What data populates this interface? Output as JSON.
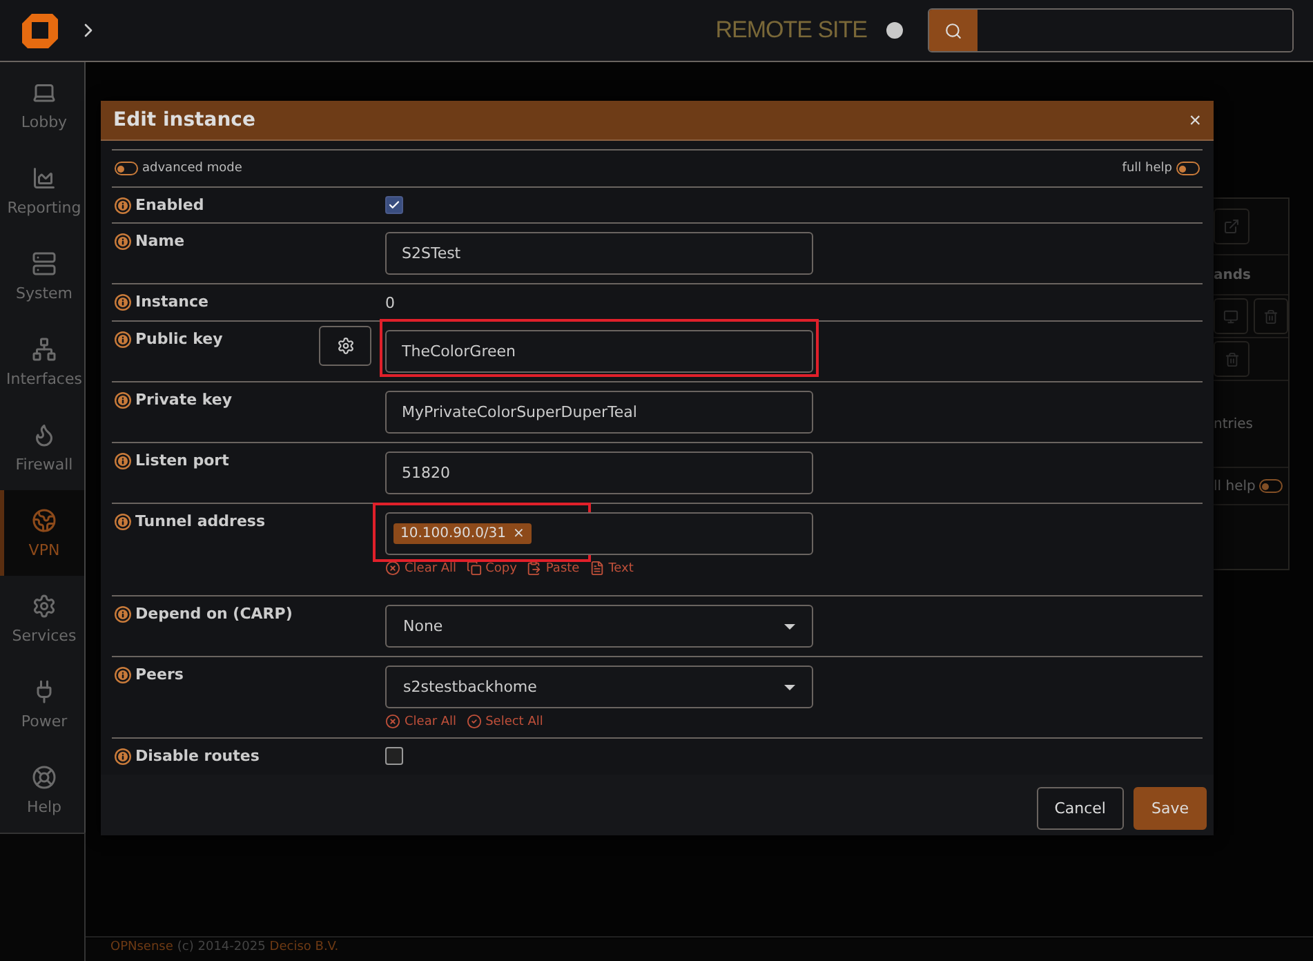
{
  "topbar": {
    "site_label": "REMOTE SITE"
  },
  "sidebar": {
    "items": [
      {
        "label": "Lobby",
        "selected": false
      },
      {
        "label": "Reporting",
        "selected": false
      },
      {
        "label": "System",
        "selected": false
      },
      {
        "label": "Interfaces",
        "selected": false
      },
      {
        "label": "Firewall",
        "selected": false
      },
      {
        "label": "VPN",
        "selected": true
      },
      {
        "label": "Services",
        "selected": false
      },
      {
        "label": "Power",
        "selected": false
      },
      {
        "label": "Help",
        "selected": false
      }
    ]
  },
  "background_panel": {
    "column_header": "ands",
    "text": "ntries",
    "help_toggle": {
      "label": "ll help",
      "on": false
    }
  },
  "dialog": {
    "title": "Edit instance",
    "close": "×",
    "advanced_mode": {
      "label": "advanced mode",
      "on": false
    },
    "full_help": {
      "label": "full help",
      "on": false
    },
    "fields": [
      {
        "kind": "checkbox",
        "label": "Enabled",
        "checked": true
      },
      {
        "kind": "input",
        "label": "Name",
        "value": "S2STest"
      },
      {
        "kind": "static",
        "label": "Instance",
        "value": "0"
      },
      {
        "kind": "key",
        "label": "Public key",
        "value": "TheColorGreen",
        "highlighted": true
      },
      {
        "kind": "input",
        "label": "Private key",
        "value": "MyPrivateColorSuperDuperTeal"
      },
      {
        "kind": "input",
        "label": "Listen port",
        "value": "51820"
      },
      {
        "kind": "tags",
        "label": "Tunnel address",
        "tags": [
          {
            "text": "10.100.90.0/31",
            "remove": "×"
          }
        ],
        "highlighted": true,
        "actions": [
          {
            "kind": "clear",
            "label": "Clear All"
          },
          {
            "kind": "copy",
            "label": "Copy"
          },
          {
            "kind": "paste",
            "label": "Paste"
          },
          {
            "kind": "text",
            "label": "Text"
          }
        ]
      },
      {
        "kind": "select",
        "label": "Depend on (CARP)",
        "value": "None"
      },
      {
        "kind": "select",
        "label": "Peers",
        "value": "s2stestbackhome",
        "actions": [
          {
            "kind": "clear",
            "label": "Clear All"
          },
          {
            "kind": "select",
            "label": "Select All"
          }
        ]
      },
      {
        "kind": "checkbox",
        "label": "Disable routes",
        "checked": false
      }
    ],
    "buttons": [
      {
        "label": "Cancel",
        "primary": false
      },
      {
        "label": "Save",
        "primary": true
      }
    ]
  },
  "footer": {
    "brand": "OPNsense",
    "copyright": "(c) 2014-2025",
    "company": "Deciso B.V."
  }
}
